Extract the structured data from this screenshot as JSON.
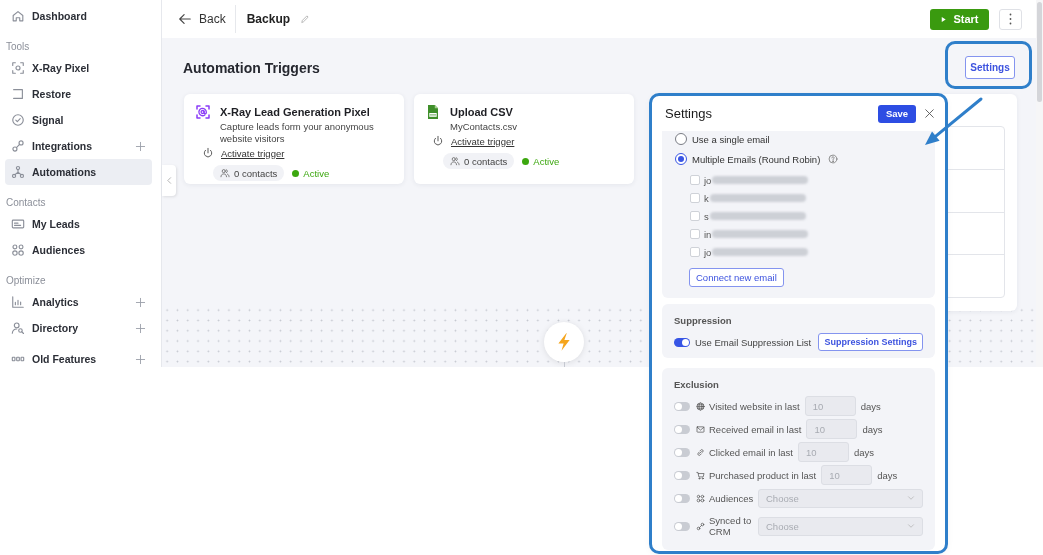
{
  "sidebar": {
    "sections": [
      {
        "items": [
          {
            "label": "Dashboard",
            "selected": false,
            "expandable": false
          }
        ]
      },
      {
        "title": "Tools",
        "items": [
          {
            "label": "X-Ray Pixel",
            "selected": false,
            "expandable": false
          },
          {
            "label": "Restore",
            "selected": false,
            "expandable": false
          },
          {
            "label": "Signal",
            "selected": false,
            "expandable": false
          },
          {
            "label": "Integrations",
            "selected": false,
            "expandable": true
          },
          {
            "label": "Automations",
            "selected": true,
            "expandable": false
          }
        ]
      },
      {
        "title": "Contacts",
        "items": [
          {
            "label": "My Leads",
            "selected": false,
            "expandable": false
          },
          {
            "label": "Audiences",
            "selected": false,
            "expandable": false
          }
        ]
      },
      {
        "title": "Optimize",
        "items": [
          {
            "label": "Analytics",
            "selected": false,
            "expandable": true
          },
          {
            "label": "Directory",
            "selected": false,
            "expandable": true
          }
        ]
      },
      {
        "items": [
          {
            "label": "Old Features",
            "selected": false,
            "expandable": true
          }
        ]
      }
    ]
  },
  "top_bar": {
    "back_label": "Back",
    "title": "Backup",
    "start_label": "Start"
  },
  "canvas": {
    "title": "Automation Triggers",
    "settings_label": "Settings",
    "triggers": [
      {
        "kind": "pixel",
        "title": "X-Ray Lead Generation Pixel",
        "description": "Capture leads form your anonymous website visitors",
        "action": "Activate trigger",
        "contacts": "0 contacts",
        "status": "Active"
      },
      {
        "kind": "csv",
        "title": "Upload CSV",
        "description": "MyContacts.csv",
        "action": "Activate trigger",
        "contacts": "0 contacts",
        "status": "Active"
      }
    ]
  },
  "settings_panel": {
    "title": "Settings",
    "save_label": "Save",
    "sending": {
      "options": [
        {
          "label": "Use a single email",
          "selected": false,
          "help": false
        },
        {
          "label": "Multiple Emails (Round Robin)",
          "selected": true,
          "help": true
        }
      ],
      "emails": [
        {
          "text": "jo",
          "checked": false
        },
        {
          "text": "k",
          "checked": false
        },
        {
          "text": "s",
          "checked": false
        },
        {
          "text": "in",
          "checked": false
        },
        {
          "text": "jo",
          "checked": false
        }
      ],
      "connect_label": "Connect new email"
    },
    "suppression": {
      "title": "Suppression",
      "toggle_label": "Use Email Suppression List",
      "on": true,
      "button_label": "Suppression Settings"
    },
    "exclusion": {
      "title": "Exclusion",
      "rules": [
        {
          "kind": "days",
          "label": "Visited website in last",
          "on": false,
          "value": "10",
          "unit": "days"
        },
        {
          "kind": "days",
          "label": "Received email in last",
          "on": false,
          "value": "10",
          "unit": "days"
        },
        {
          "kind": "days",
          "label": "Clicked email in last",
          "on": false,
          "value": "10",
          "unit": "days"
        },
        {
          "kind": "days",
          "label": "Purchased product in last",
          "on": false,
          "value": "10",
          "unit": "days"
        },
        {
          "kind": "select",
          "label": "Audiences",
          "on": false,
          "placeholder": "Choose"
        },
        {
          "kind": "select",
          "label": "Synced to CRM",
          "on": false,
          "placeholder": "Choose"
        }
      ]
    }
  }
}
